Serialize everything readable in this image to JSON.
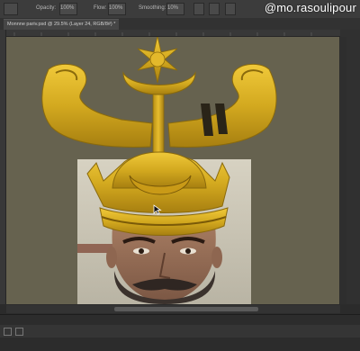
{
  "app": {
    "name": "Photoshop"
  },
  "options_bar": {
    "fields": [
      "Opacity:",
      "100%",
      "Flow:",
      "100%",
      "Smoothing:",
      "10%"
    ]
  },
  "document_tab": {
    "label": "Monnne pariv.psd @ 29.5% (Layer 24, RGB/8#) *"
  },
  "watermark": {
    "text": "@mo.rasoulipour"
  },
  "colors": {
    "canvas": "#66624f",
    "gold": "#d3a91f",
    "gold_dark": "#8a6a0c"
  }
}
